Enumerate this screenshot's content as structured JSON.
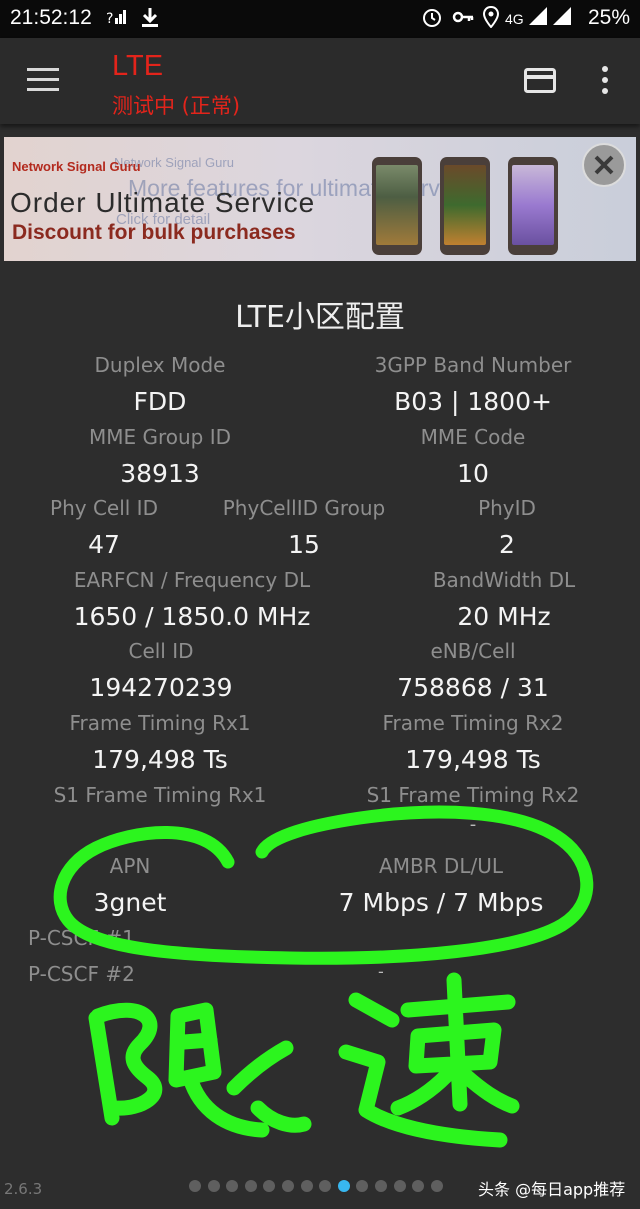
{
  "status_bar": {
    "time": "21:52:12",
    "network": "4G",
    "battery": "25%",
    "icons": [
      "signal-unknown-icon",
      "download-icon",
      "alarm-icon",
      "vpn-key-icon",
      "location-icon",
      "signal-icon",
      "battery-icon"
    ]
  },
  "app_bar": {
    "title": "LTE",
    "subtitle": "测试中 (正常)",
    "title_color": "#e3241b",
    "icons": [
      "menu-icon",
      "card-icon",
      "more-vert-icon"
    ]
  },
  "ad": {
    "brand": "Network Signal Guru",
    "headline": "Order Ultimate Service",
    "discount": "Discount for bulk purchases",
    "bg_brand": "Network Signal Guru",
    "bg_more": "More features for ultimate service",
    "bg_click": "Click for detail"
  },
  "section": {
    "title": "LTE小区配置",
    "duplex_mode": {
      "label": "Duplex Mode",
      "value": "FDD"
    },
    "band_number": {
      "label": "3GPP Band Number",
      "value": "B03 | 1800+"
    },
    "mme_group_id": {
      "label": "MME Group ID",
      "value": "38913"
    },
    "mme_code": {
      "label": "MME Code",
      "value": "10"
    },
    "phy_cell_id": {
      "label": "Phy Cell ID",
      "value": "47"
    },
    "phycellid_group": {
      "label": "PhyCellID Group",
      "value": "15"
    },
    "phy_id": {
      "label": "PhyID",
      "value": "2"
    },
    "earfcn": {
      "label": "EARFCN / Frequency DL",
      "value": "1650 / 1850.0 MHz"
    },
    "bandwidth_dl": {
      "label": "BandWidth DL",
      "value": "20 MHz"
    },
    "cell_id": {
      "label": "Cell ID",
      "value": "194270239"
    },
    "enb_cell": {
      "label": "eNB/Cell",
      "value": "758868 / 31"
    },
    "frame_timing_rx1": {
      "label": "Frame Timing Rx1",
      "value": "179,498 Ts"
    },
    "frame_timing_rx2": {
      "label": "Frame Timing Rx2",
      "value": "179,498 Ts"
    },
    "s1_frame_timing_rx1": {
      "label": "S1 Frame Timing Rx1",
      "value": ""
    },
    "s1_frame_timing_rx2": {
      "label": "S1 Frame Timing Rx2",
      "value": "-"
    },
    "apn": {
      "label": "APN",
      "value": "3gnet"
    },
    "ambr": {
      "label": "AMBR DL/UL",
      "value": "7 Mbps / 7 Mbps"
    },
    "pcscf1": {
      "label": "P-CSCF #1",
      "value": ""
    },
    "pcscf2": {
      "label": "P-CSCF #2",
      "value": "-"
    }
  },
  "annotation": {
    "text": "限速",
    "color": "#2cf51e"
  },
  "pager": {
    "count": 14,
    "active_index": 8,
    "active_color": "#38b7f0"
  },
  "footer": {
    "version": "2.6.3",
    "watermark": "头条 @每日app推荐"
  }
}
